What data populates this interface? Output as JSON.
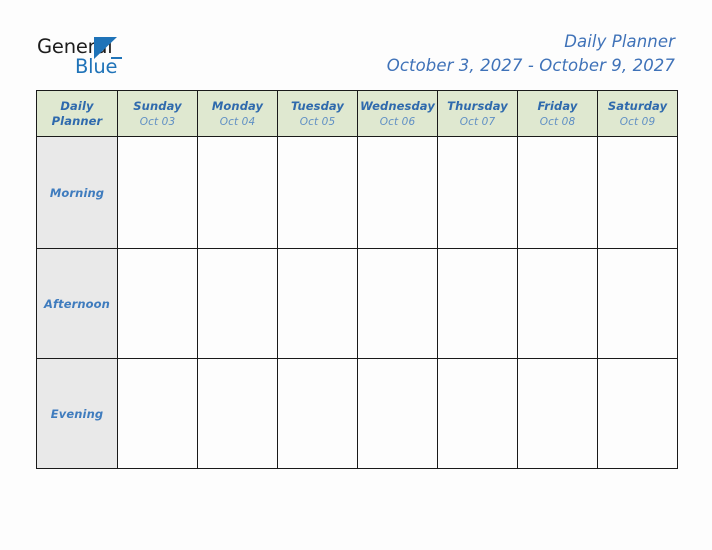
{
  "logo": {
    "word_dark": "General",
    "word_blue": "Blue",
    "triangle_icon": "triangle-icon",
    "brand_color": "#1f73b8",
    "dark_color": "#1d1d1d"
  },
  "header": {
    "title": "Daily Planner",
    "date_range": "October 3, 2027 - October 9, 2027",
    "title_color": "#3f72b8"
  },
  "table": {
    "corner": {
      "line1": "Daily",
      "line2": "Planner"
    },
    "header_bg": "#dfe8d0",
    "label_bg": "#e9e9e9",
    "cell_bg": "#fdfdfd",
    "border_color": "#1a1a1a",
    "day_text_color": "#2f6aad",
    "date_text_color": "#5f8fc4",
    "slot_text_color": "#3f7cbe",
    "days": [
      {
        "name": "Sunday",
        "date": "Oct 03"
      },
      {
        "name": "Monday",
        "date": "Oct 04"
      },
      {
        "name": "Tuesday",
        "date": "Oct 05"
      },
      {
        "name": "Wednesday",
        "date": "Oct 06"
      },
      {
        "name": "Thursday",
        "date": "Oct 07"
      },
      {
        "name": "Friday",
        "date": "Oct 08"
      },
      {
        "name": "Saturday",
        "date": "Oct 09"
      }
    ],
    "slots": [
      {
        "label": "Morning",
        "entries": [
          "",
          "",
          "",
          "",
          "",
          "",
          ""
        ]
      },
      {
        "label": "Afternoon",
        "entries": [
          "",
          "",
          "",
          "",
          "",
          "",
          ""
        ]
      },
      {
        "label": "Evening",
        "entries": [
          "",
          "",
          "",
          "",
          "",
          "",
          ""
        ]
      }
    ]
  }
}
